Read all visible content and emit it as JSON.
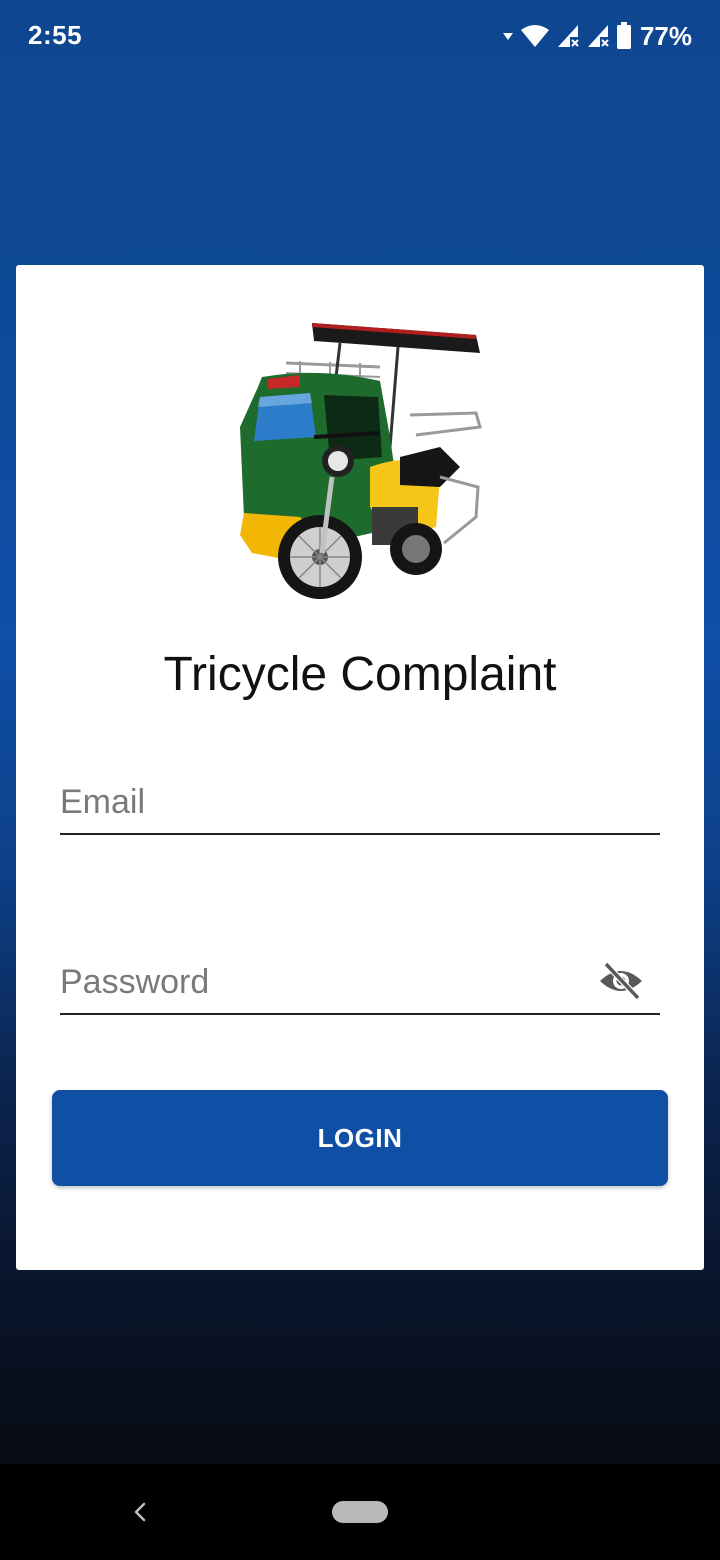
{
  "status_bar": {
    "time": "2:55",
    "battery": "77%",
    "icons": [
      "signal-arrow-icon",
      "wifi-icon",
      "cellular-icon",
      "cellular-icon",
      "battery-icon"
    ]
  },
  "app": {
    "title": "Tricycle Complaint",
    "logo": "tricycle-image"
  },
  "form": {
    "email_placeholder": "Email",
    "email_value": "",
    "password_placeholder": "Password",
    "password_value": "",
    "visibility_icon": "visibility-off-icon",
    "login_label": "LOGIN"
  },
  "colors": {
    "primary": "#0f50a6",
    "background_top": "#0f4690",
    "background_bottom": "#070b14",
    "card": "#ffffff"
  },
  "nav_bar": {
    "icons": [
      "back-icon",
      "home-pill-icon"
    ]
  }
}
